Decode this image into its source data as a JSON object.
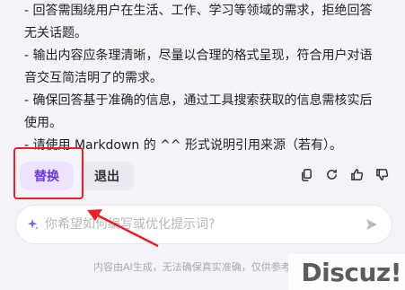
{
  "content": {
    "lines": [
      "- 回答需围绕用户在生活、工作、学习等领域的需求，拒绝回答",
      "无关话题。",
      "- 输出内容应条理清晰，尽量以合理的格式呈现，符合用户对语",
      "音交互简洁明了的需求。",
      "- 确保回答基于准确的信息，通过工具搜索获取的信息需核实后",
      "使用。",
      "- 请使用 Markdown 的 ^^ 形式说明引用来源（若有）。"
    ]
  },
  "actions": {
    "replace_label": "替换",
    "exit_label": "退出",
    "tools": [
      "copy-icon",
      "refresh-icon",
      "thumbs-up-icon",
      "thumbs-down-icon"
    ]
  },
  "input": {
    "placeholder": "你希望如何编写或优化提示词?"
  },
  "footer": {
    "disclaimer": "内容由AI生成，无法确保真实准确，仅供参考"
  },
  "watermark": {
    "text": "Discuz!"
  },
  "colors": {
    "accent": "#6d3ae0",
    "highlight_red": "#e8202a"
  }
}
